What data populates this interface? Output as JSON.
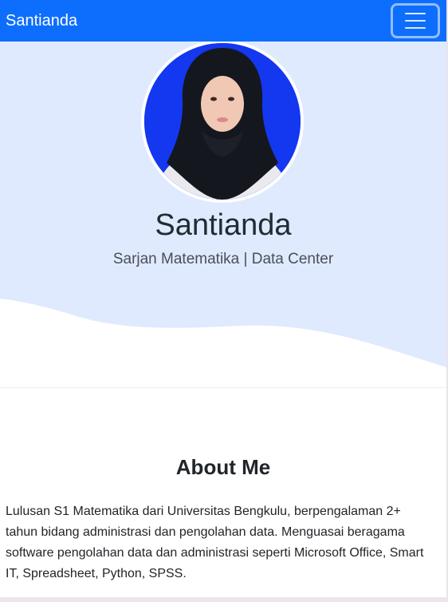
{
  "navbar": {
    "brand": "Santianda",
    "toggle_icon": "hamburger-menu-icon"
  },
  "hero": {
    "name": "Santianda",
    "subtitle": "Sarjan Matematika | Data Center",
    "background_color": "#dfeafe",
    "avatar_background": "#1437f0"
  },
  "about": {
    "title": "About Me",
    "text": "Lulusan S1 Matematika dari Universitas Bengkulu, berpengalaman 2+ tahun bidang administrasi dan pengolahan data. Menguasai beragama software pengolahan data dan administrasi seperti Microsoft Office, Smart IT, Spreadsheet, Python, SPSS."
  },
  "colors": {
    "primary": "#0d6efd",
    "text": "#212529"
  }
}
